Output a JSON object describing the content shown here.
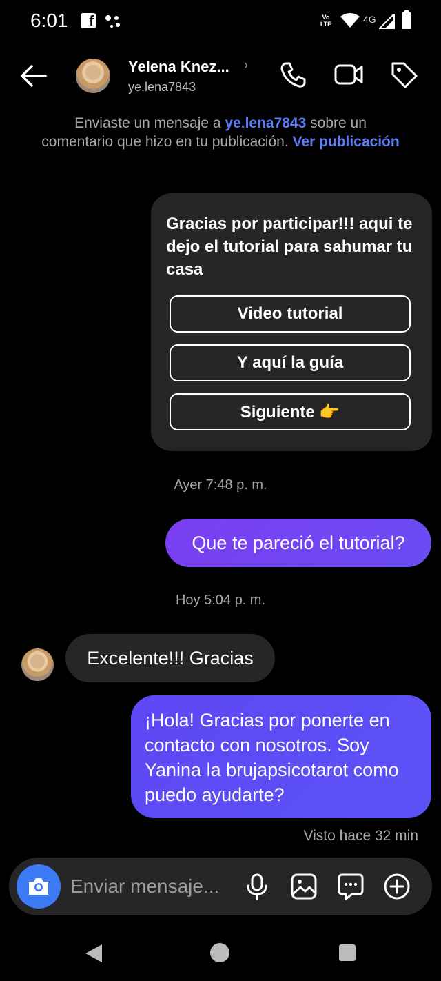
{
  "status_bar": {
    "time": "6:01",
    "network_label": "4G",
    "volte_label": "Vo LTE"
  },
  "header": {
    "contact_name": "Yelena Knez...",
    "contact_username": "ye.lena7843",
    "icons": [
      "back-arrow-icon",
      "phone-icon",
      "video-camera-icon",
      "tag-icon"
    ]
  },
  "notice": {
    "part1": "Enviaste un mensaje a ",
    "username": "ye.lena7843",
    "part2": " sobre un comentario que hizo en tu publicación. ",
    "link": "Ver publicación"
  },
  "template_card": {
    "text": "Gracias por participar!!! aqui te dejo el tutorial para sahumar tu casa",
    "buttons": [
      "Video tutorial",
      "Y aquí la guía",
      "Siguiente 👉"
    ]
  },
  "timestamps": {
    "first": "Ayer 7:48 p. m.",
    "second": "Hoy 5:04 p. m."
  },
  "messages": {
    "outgoing_1": "Que te pareció el  tutorial?",
    "incoming_1": "Excelente!!! Gracias",
    "outgoing_2": "¡Hola! Gracias por ponerte en contacto con nosotros. Soy Yanina la brujapsicotarot como puedo ayudarte?"
  },
  "seen_status": "Visto hace 32 min",
  "composer": {
    "placeholder": "Enviar mensaje...",
    "icons": [
      "camera-icon",
      "microphone-icon",
      "gallery-icon",
      "sticker-chat-icon",
      "plus-icon"
    ]
  },
  "colors": {
    "accent": "#3d7bf5",
    "outgoing_bubble": "#7b3ef0",
    "link": "#5b7cf7",
    "bubble_dark": "#262629"
  }
}
